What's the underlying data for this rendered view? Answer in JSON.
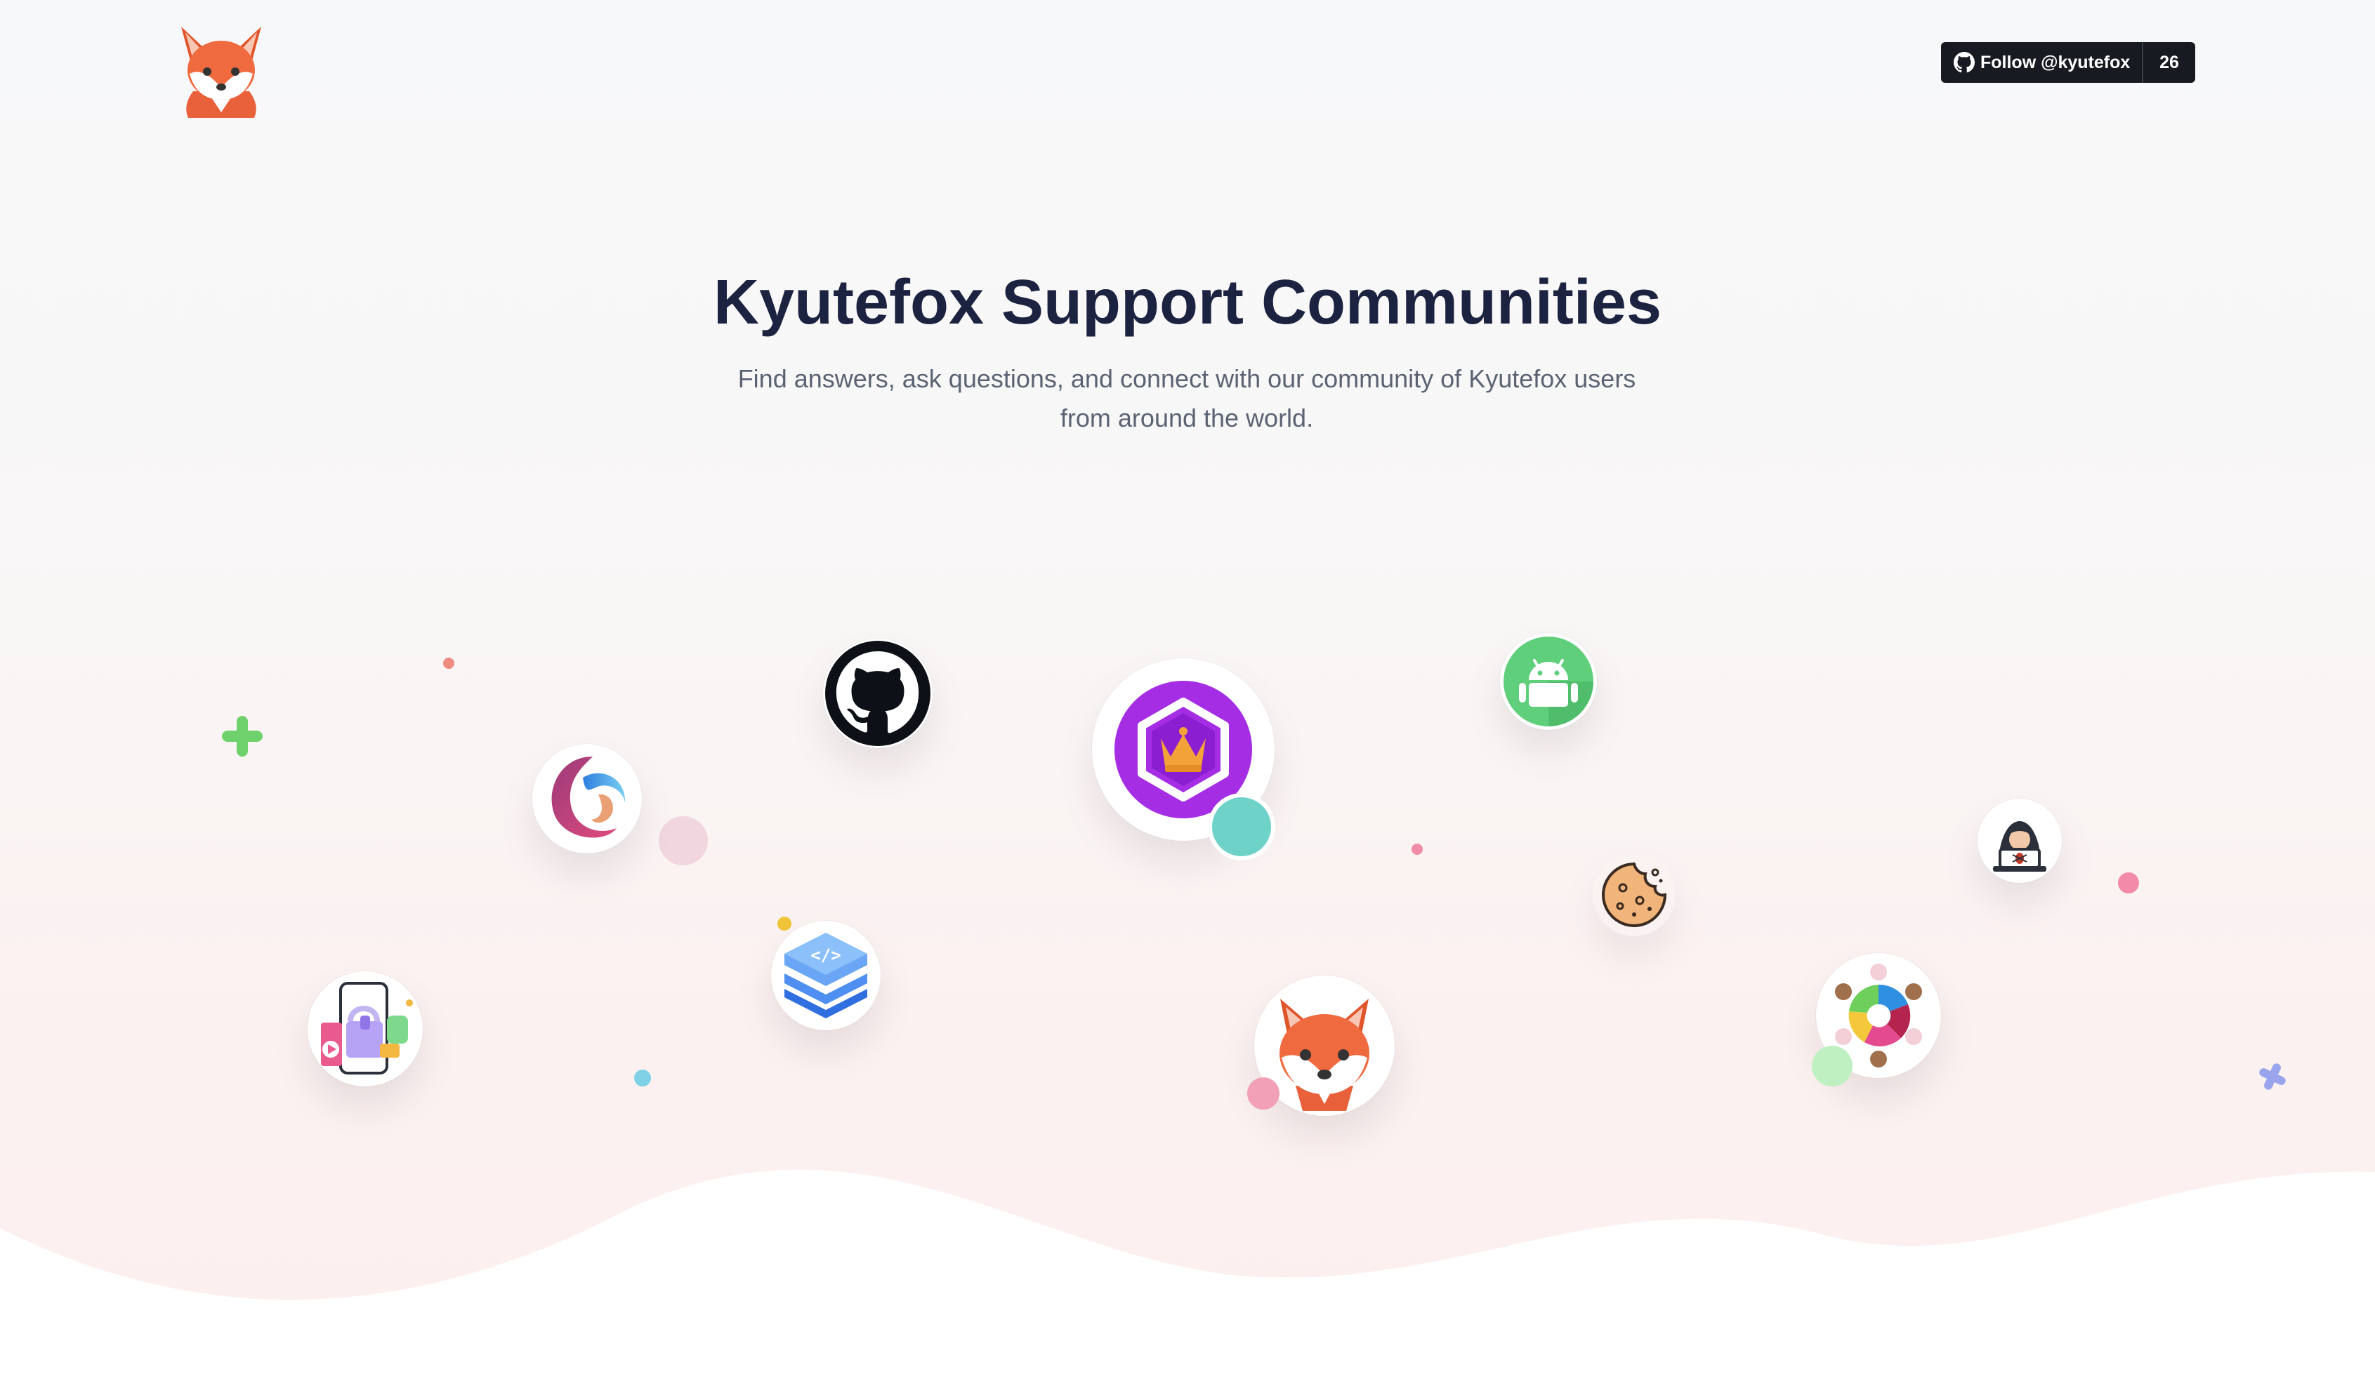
{
  "header": {
    "logo_icon": "fox-logo",
    "github_follow_label": "Follow @kyutefox",
    "github_follow_count": "26"
  },
  "hero": {
    "title": "Kyutefox Support Communities",
    "subtitle": "Find answers, ask questions, and connect with our community of Kyutefox users from around the world."
  },
  "communities": [
    {
      "icon": "github-icon"
    },
    {
      "icon": "crown-hexagon-icon"
    },
    {
      "icon": "android-icon"
    },
    {
      "icon": "swirl-c-icon"
    },
    {
      "icon": "hacker-bug-icon"
    },
    {
      "icon": "cookie-icon"
    },
    {
      "icon": "code-layers-icon"
    },
    {
      "icon": "mobile-shop-icon"
    },
    {
      "icon": "fox-icon"
    },
    {
      "icon": "people-circle-icon"
    }
  ],
  "colors": {
    "title": "#1c2341",
    "subtitle": "#5b6373",
    "button_bg": "#171b21",
    "crown_purple": "#a52ee5",
    "android_green": "#5fcf7c"
  }
}
